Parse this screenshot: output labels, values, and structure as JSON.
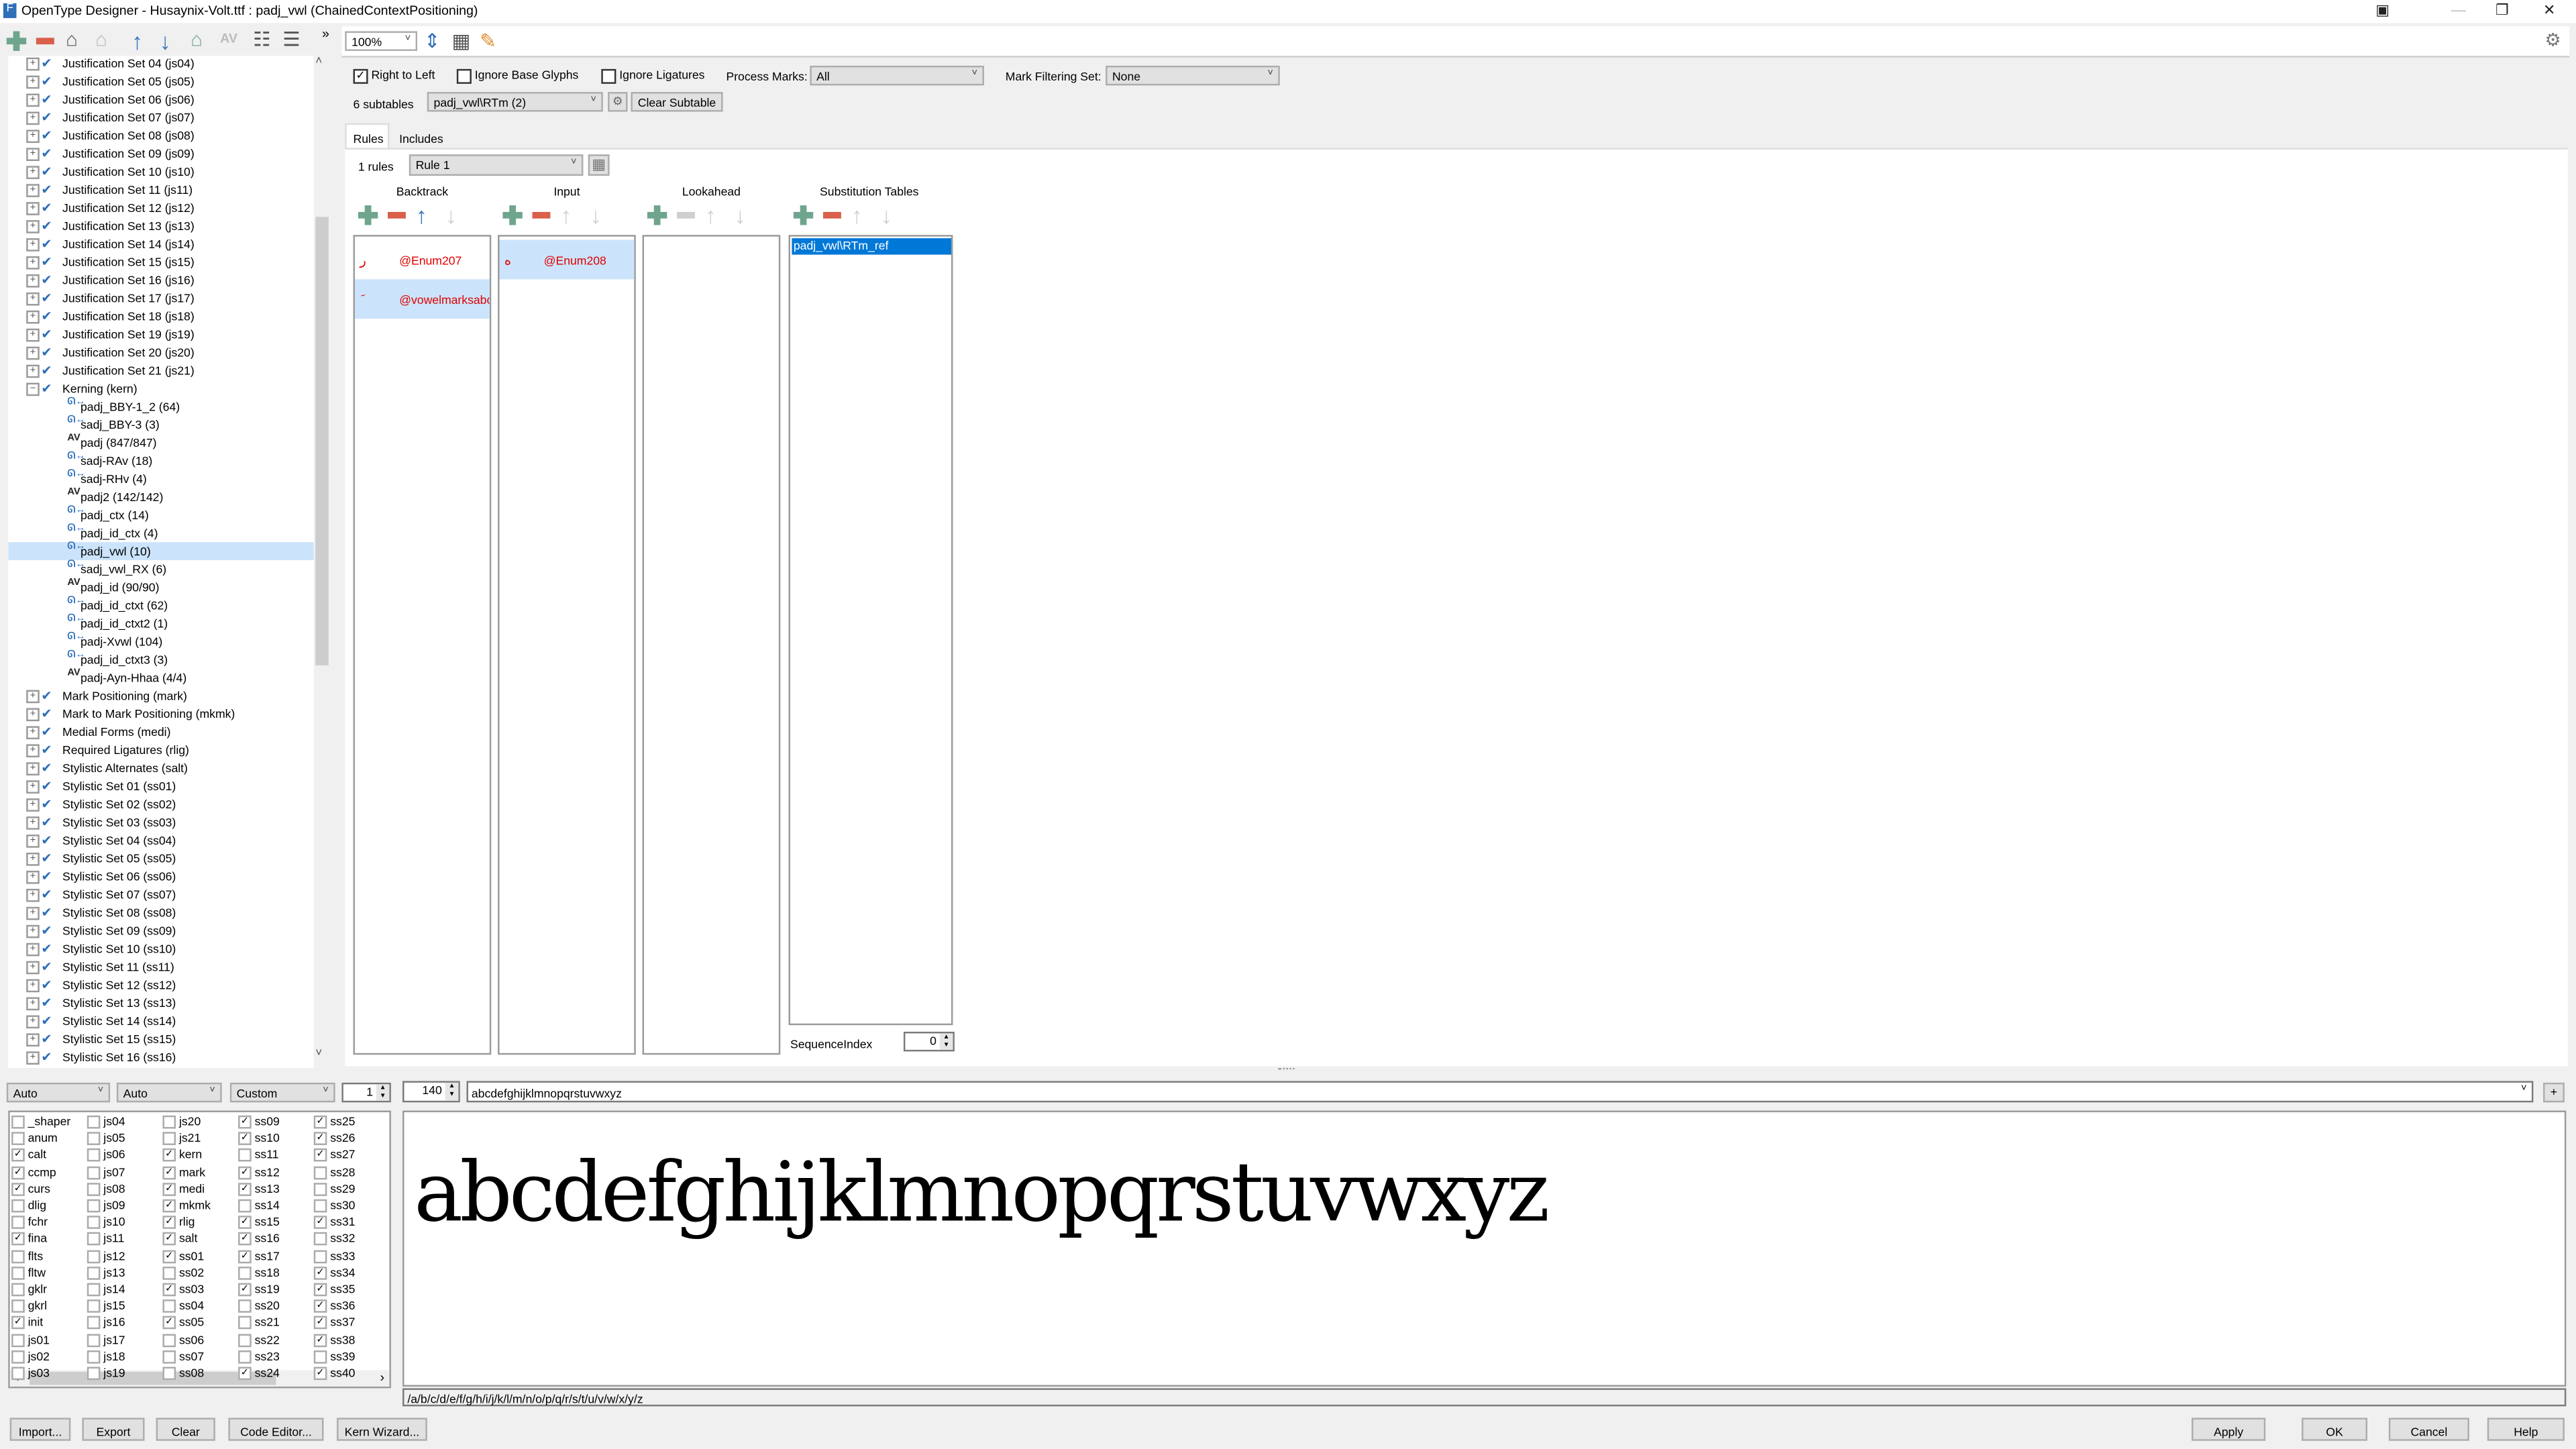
{
  "window": {
    "title": "OpenType Designer - Husaynix-Volt.ttf : padj_vwl (ChainedContextPositioning)",
    "controls": [
      "minimize",
      "restore",
      "close"
    ]
  },
  "toolbar_left": {
    "icons": [
      "add-icon",
      "remove-icon",
      "tag-icon",
      "tag-disabled-icon",
      "move-up-icon",
      "move-down-icon",
      "tag-edit-icon",
      "kern-disabled-icon",
      "expand-tree-icon",
      "collapse-tree-icon"
    ],
    "overflow": "»"
  },
  "tree": {
    "items": [
      {
        "label": "Justification Set 04 (js04)",
        "level": 0,
        "exp": "+"
      },
      {
        "label": "Justification Set 05 (js05)",
        "level": 0,
        "exp": "+"
      },
      {
        "label": "Justification Set 06 (js06)",
        "level": 0,
        "exp": "+"
      },
      {
        "label": "Justification Set 07 (js07)",
        "level": 0,
        "exp": "+"
      },
      {
        "label": "Justification Set 08 (js08)",
        "level": 0,
        "exp": "+"
      },
      {
        "label": "Justification Set 09 (js09)",
        "level": 0,
        "exp": "+"
      },
      {
        "label": "Justification Set 10 (js10)",
        "level": 0,
        "exp": "+"
      },
      {
        "label": "Justification Set 11 (js11)",
        "level": 0,
        "exp": "+"
      },
      {
        "label": "Justification Set 12 (js12)",
        "level": 0,
        "exp": "+"
      },
      {
        "label": "Justification Set 13 (js13)",
        "level": 0,
        "exp": "+"
      },
      {
        "label": "Justification Set 14 (js14)",
        "level": 0,
        "exp": "+"
      },
      {
        "label": "Justification Set 15 (js15)",
        "level": 0,
        "exp": "+"
      },
      {
        "label": "Justification Set 16 (js16)",
        "level": 0,
        "exp": "+"
      },
      {
        "label": "Justification Set 17 (js17)",
        "level": 0,
        "exp": "+"
      },
      {
        "label": "Justification Set 18 (js18)",
        "level": 0,
        "exp": "+"
      },
      {
        "label": "Justification Set 19 (js19)",
        "level": 0,
        "exp": "+"
      },
      {
        "label": "Justification Set 20 (js20)",
        "level": 0,
        "exp": "+"
      },
      {
        "label": "Justification Set 21 (js21)",
        "level": 0,
        "exp": "+"
      },
      {
        "label": "Kerning (kern)",
        "level": 0,
        "exp": "−"
      },
      {
        "label": "padj_BBY-1_2 (64)",
        "level": 1,
        "icon": "ctx"
      },
      {
        "label": "sadj_BBY-3 (3)",
        "level": 1,
        "icon": "ctx"
      },
      {
        "label": "padj (847/847)",
        "level": 1,
        "icon": "AV"
      },
      {
        "label": "sadj-RAv (18)",
        "level": 1,
        "icon": "ctx"
      },
      {
        "label": "sadj-RHv (4)",
        "level": 1,
        "icon": "ctx"
      },
      {
        "label": "padj2 (142/142)",
        "level": 1,
        "icon": "AV"
      },
      {
        "label": "padj_ctx (14)",
        "level": 1,
        "icon": "ctx"
      },
      {
        "label": "padj_id_ctx (4)",
        "level": 1,
        "icon": "ctx"
      },
      {
        "label": "padj_vwl (10)",
        "level": 1,
        "icon": "ctx",
        "selected": true
      },
      {
        "label": "sadj_vwl_RX (6)",
        "level": 1,
        "icon": "ctx"
      },
      {
        "label": "padj_id (90/90)",
        "level": 1,
        "icon": "AV"
      },
      {
        "label": "padj_id_ctxt (62)",
        "level": 1,
        "icon": "ctx"
      },
      {
        "label": "padj_id_ctxt2 (1)",
        "level": 1,
        "icon": "ctx"
      },
      {
        "label": "padj-Xvwl (104)",
        "level": 1,
        "icon": "ctx"
      },
      {
        "label": "padj_id_ctxt3 (3)",
        "level": 1,
        "icon": "ctx"
      },
      {
        "label": "padj-Ayn-Hhaa (4/4)",
        "level": 1,
        "icon": "AV"
      },
      {
        "label": "Mark Positioning (mark)",
        "level": 0,
        "exp": "+"
      },
      {
        "label": "Mark to Mark Positioning (mkmk)",
        "level": 0,
        "exp": "+"
      },
      {
        "label": "Medial Forms (medi)",
        "level": 0,
        "exp": "+"
      },
      {
        "label": "Required Ligatures (rlig)",
        "level": 0,
        "exp": "+"
      },
      {
        "label": "Stylistic Alternates (salt)",
        "level": 0,
        "exp": "+"
      },
      {
        "label": "Stylistic Set 01 (ss01)",
        "level": 0,
        "exp": "+"
      },
      {
        "label": "Stylistic Set 02 (ss02)",
        "level": 0,
        "exp": "+"
      },
      {
        "label": "Stylistic Set 03 (ss03)",
        "level": 0,
        "exp": "+"
      },
      {
        "label": "Stylistic Set 04 (ss04)",
        "level": 0,
        "exp": "+"
      },
      {
        "label": "Stylistic Set 05 (ss05)",
        "level": 0,
        "exp": "+"
      },
      {
        "label": "Stylistic Set 06 (ss06)",
        "level": 0,
        "exp": "+"
      },
      {
        "label": "Stylistic Set 07 (ss07)",
        "level": 0,
        "exp": "+"
      },
      {
        "label": "Stylistic Set 08 (ss08)",
        "level": 0,
        "exp": "+"
      },
      {
        "label": "Stylistic Set 09 (ss09)",
        "level": 0,
        "exp": "+"
      },
      {
        "label": "Stylistic Set 10 (ss10)",
        "level": 0,
        "exp": "+"
      },
      {
        "label": "Stylistic Set 11 (ss11)",
        "level": 0,
        "exp": "+"
      },
      {
        "label": "Stylistic Set 12 (ss12)",
        "level": 0,
        "exp": "+"
      },
      {
        "label": "Stylistic Set 13 (ss13)",
        "level": 0,
        "exp": "+"
      },
      {
        "label": "Stylistic Set 14 (ss14)",
        "level": 0,
        "exp": "+"
      },
      {
        "label": "Stylistic Set 15 (ss15)",
        "level": 0,
        "exp": "+"
      },
      {
        "label": "Stylistic Set 16 (ss16)",
        "level": 0,
        "exp": "+"
      }
    ]
  },
  "zoom": {
    "value": "100%"
  },
  "options": {
    "right_to_left": {
      "label": "Right to Left",
      "checked": true
    },
    "ignore_base": {
      "label": "Ignore Base Glyphs",
      "checked": false
    },
    "ignore_lig": {
      "label": "Ignore Ligatures",
      "checked": false
    },
    "process_marks_label": "Process Marks:",
    "process_marks_value": "All",
    "mark_filter_label": "Mark Filtering Set:",
    "mark_filter_value": "None"
  },
  "subtables": {
    "count_label": "6 subtables",
    "selected": "padj_vwl\\RTm (2)",
    "clear_label": "Clear Subtable"
  },
  "tabs": [
    {
      "label": "Rules",
      "active": true
    },
    {
      "label": "Includes",
      "active": false
    }
  ],
  "rules": {
    "count_label": "1 rules",
    "selected": "Rule 1"
  },
  "columns": {
    "backtrack": {
      "title": "Backtrack",
      "entries": [
        {
          "glyph": "ر",
          "label": "@Enum207",
          "hl": false
        },
        {
          "glyph": "َ",
          "label": "@vowelmarksabov",
          "hl": true
        }
      ]
    },
    "input": {
      "title": "Input",
      "entries": [
        {
          "glyph": "ه",
          "label": "@Enum208",
          "hl": true
        }
      ]
    },
    "lookahead": {
      "title": "Lookahead",
      "entries": []
    },
    "substitution": {
      "title": "Substitution Tables",
      "entries": [
        "padj_vwl\\RTm_ref"
      ]
    }
  },
  "sequence_index": {
    "label": "SequenceIndex",
    "value": "0"
  },
  "bottom": {
    "script": "Auto",
    "language": "Auto",
    "feature_mode": "Custom",
    "count": "1",
    "size": "140",
    "sample_text": "abcdefghijklmnopqrstuvwxyz",
    "glyph_string": "/a/b/c/d/e/f/g/h/i/j/k/l/m/n/o/p/q/r/s/t/u/v/w/x/y/z",
    "add_label": "+"
  },
  "features": [
    [
      [
        "_shaper",
        false
      ],
      [
        "anum",
        false
      ],
      [
        "calt",
        true
      ],
      [
        "ccmp",
        true
      ],
      [
        "curs",
        true
      ],
      [
        "dlig",
        false
      ],
      [
        "fchr",
        false
      ],
      [
        "fina",
        true
      ],
      [
        "flts",
        false
      ],
      [
        "fltw",
        false
      ],
      [
        "gklr",
        false
      ],
      [
        "gkrl",
        false
      ],
      [
        "init",
        true
      ],
      [
        "js01",
        false
      ],
      [
        "js02",
        false
      ],
      [
        "js03",
        false
      ]
    ],
    [
      [
        "js04",
        false
      ],
      [
        "js05",
        false
      ],
      [
        "js06",
        false
      ],
      [
        "js07",
        false
      ],
      [
        "js08",
        false
      ],
      [
        "js09",
        false
      ],
      [
        "js10",
        false
      ],
      [
        "js11",
        false
      ],
      [
        "js12",
        false
      ],
      [
        "js13",
        false
      ],
      [
        "js14",
        false
      ],
      [
        "js15",
        false
      ],
      [
        "js16",
        false
      ],
      [
        "js17",
        false
      ],
      [
        "js18",
        false
      ],
      [
        "js19",
        false
      ]
    ],
    [
      [
        "js20",
        false
      ],
      [
        "js21",
        false
      ],
      [
        "kern",
        true
      ],
      [
        "mark",
        true
      ],
      [
        "medi",
        true
      ],
      [
        "mkmk",
        true
      ],
      [
        "rlig",
        true
      ],
      [
        "salt",
        true
      ],
      [
        "ss01",
        true
      ],
      [
        "ss02",
        false
      ],
      [
        "ss03",
        true
      ],
      [
        "ss04",
        false
      ],
      [
        "ss05",
        true
      ],
      [
        "ss06",
        false
      ],
      [
        "ss07",
        false
      ],
      [
        "ss08",
        false
      ]
    ],
    [
      [
        "ss09",
        true
      ],
      [
        "ss10",
        true
      ],
      [
        "ss11",
        false
      ],
      [
        "ss12",
        true
      ],
      [
        "ss13",
        true
      ],
      [
        "ss14",
        false
      ],
      [
        "ss15",
        true
      ],
      [
        "ss16",
        true
      ],
      [
        "ss17",
        true
      ],
      [
        "ss18",
        false
      ],
      [
        "ss19",
        true
      ],
      [
        "ss20",
        false
      ],
      [
        "ss21",
        false
      ],
      [
        "ss22",
        false
      ],
      [
        "ss23",
        false
      ],
      [
        "ss24",
        true
      ]
    ],
    [
      [
        "ss25",
        true
      ],
      [
        "ss26",
        true
      ],
      [
        "ss27",
        true
      ],
      [
        "ss28",
        false
      ],
      [
        "ss29",
        false
      ],
      [
        "ss30",
        false
      ],
      [
        "ss31",
        true
      ],
      [
        "ss32",
        false
      ],
      [
        "ss33",
        false
      ],
      [
        "ss34",
        true
      ],
      [
        "ss35",
        true
      ],
      [
        "ss36",
        true
      ],
      [
        "ss37",
        true
      ],
      [
        "ss38",
        true
      ],
      [
        "ss39",
        false
      ],
      [
        "ss40",
        true
      ]
    ]
  ],
  "buttons": {
    "import": "Import...",
    "export": "Export",
    "clear": "Clear",
    "code_editor": "Code Editor...",
    "kern_wizard": "Kern Wizard...",
    "apply": "Apply",
    "ok": "OK",
    "cancel": "Cancel",
    "help": "Help"
  },
  "colors": {
    "accent": "#0078d7",
    "selection": "#cce4fb",
    "add": "#6fa58e",
    "remove": "#d9604a",
    "glyph_text": "#e00000"
  }
}
